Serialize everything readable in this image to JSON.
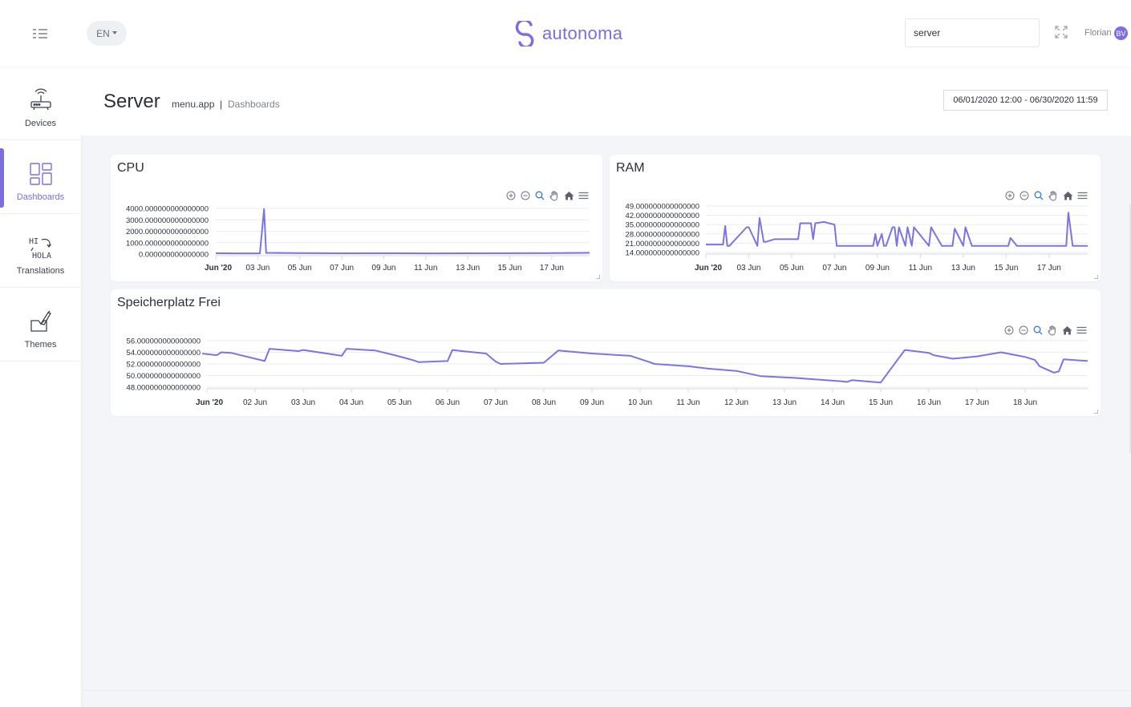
{
  "header": {
    "language": "EN",
    "logo_text": "autonoma",
    "search_value": "server",
    "user_name": "Florian",
    "avatar_initials": "BV"
  },
  "sidebar": {
    "items": [
      {
        "label": "Devices",
        "icon": "router-icon",
        "active": false
      },
      {
        "label": "Dashboards",
        "icon": "dashboard-grid-icon",
        "active": true
      },
      {
        "label": "Translations",
        "icon": "translate-icon",
        "active": false
      },
      {
        "label": "Themes",
        "icon": "paint-brush-icon",
        "active": false
      }
    ],
    "translate_icon_top": "HI",
    "translate_icon_bottom": "HOLA"
  },
  "page": {
    "title": "Server",
    "breadcrumb_app": "menu.app",
    "breadcrumb_sep": "|",
    "breadcrumb_current": "Dashboards",
    "date_range": "06/01/2020 12:00 - 06/30/2020 11:59"
  },
  "colors": {
    "accent": "#7b6ee4",
    "series": "#7c73e6",
    "grid": "#e9ebef",
    "text": "#3c4250"
  },
  "toolbar_icons": [
    "zoom-in-icon",
    "zoom-out-icon",
    "selection-zoom-icon",
    "pan-icon",
    "reset-home-icon",
    "menu-icon"
  ],
  "chart_data": [
    {
      "type": "line",
      "title": "CPU",
      "ytick_labels": [
        "4000.000000000000000",
        "3000.000000000000000",
        "2000.000000000000000",
        "1000.000000000000000",
        "0.000000000000000"
      ],
      "yticks": [
        4000,
        3000,
        2000,
        1000,
        0
      ],
      "ylim": [
        0,
        4000
      ],
      "xlim": [
        1,
        18.8
      ],
      "xticks": [
        {
          "label": "Jun '20",
          "day": 1,
          "bold": true
        },
        {
          "label": "03 Jun",
          "day": 3
        },
        {
          "label": "05 Jun",
          "day": 5
        },
        {
          "label": "07 Jun",
          "day": 7
        },
        {
          "label": "09 Jun",
          "day": 9
        },
        {
          "label": "11 Jun",
          "day": 11
        },
        {
          "label": "13 Jun",
          "day": 13
        },
        {
          "label": "15 Jun",
          "day": 15
        },
        {
          "label": "17 Jun",
          "day": 17
        }
      ],
      "series": [
        {
          "x": [
            1,
            2,
            3.1,
            3.3,
            3.4,
            5,
            7,
            9,
            11,
            13,
            15,
            17,
            18.8
          ],
          "y": [
            80,
            60,
            60,
            3950,
            110,
            90,
            70,
            80,
            60,
            70,
            80,
            90,
            110
          ]
        }
      ]
    },
    {
      "type": "line",
      "title": "RAM",
      "ytick_labels": [
        "49.000000000000000",
        "42.000000000000000",
        "35.000000000000000",
        "28.000000000000000",
        "21.000000000000000",
        "14.000000000000000"
      ],
      "yticks": [
        49,
        42,
        35,
        28,
        21,
        14
      ],
      "ylim": [
        14,
        49
      ],
      "xlim": [
        1,
        18.8
      ],
      "xticks": [
        {
          "label": "Jun '20",
          "day": 1,
          "bold": true
        },
        {
          "label": "03 Jun",
          "day": 3
        },
        {
          "label": "05 Jun",
          "day": 5
        },
        {
          "label": "07 Jun",
          "day": 7
        },
        {
          "label": "09 Jun",
          "day": 9
        },
        {
          "label": "11 Jun",
          "day": 11
        },
        {
          "label": "13 Jun",
          "day": 13
        },
        {
          "label": "15 Jun",
          "day": 15
        },
        {
          "label": "17 Jun",
          "day": 17
        }
      ],
      "series": [
        {
          "x": [
            1,
            1.8,
            1.9,
            2.0,
            2.1,
            2.9,
            3.0,
            3.4,
            3.5,
            3.7,
            3.8,
            4.2,
            4.5,
            5.3,
            5.4,
            5.9,
            6.0,
            6.1,
            6.5,
            7.0,
            7.1,
            7.5,
            7.6,
            8.8,
            8.9,
            9.0,
            9.2,
            9.3,
            9.4,
            9.7,
            9.8,
            9.9,
            10.0,
            10.3,
            10.4,
            10.6,
            10.7,
            11.4,
            11.5,
            12.0,
            12.1,
            12.5,
            12.6,
            13.0,
            13.1,
            13.4,
            13.5,
            13.8,
            15.0,
            15.1,
            15.2,
            15.5,
            17.0,
            17.8,
            17.9,
            18.1,
            18.8
          ],
          "y": [
            20,
            20,
            34,
            19,
            19,
            33,
            33,
            19,
            40,
            22,
            22,
            24,
            24,
            24,
            36,
            36,
            24,
            36,
            37,
            35,
            19,
            19,
            19,
            19,
            28,
            19,
            28,
            19,
            19,
            33,
            33,
            19,
            33,
            19,
            33,
            19,
            33,
            19,
            33,
            19,
            19,
            19,
            32,
            19,
            33,
            19,
            19,
            19,
            19,
            19,
            25,
            19,
            19,
            19,
            44,
            19,
            19
          ]
        }
      ]
    },
    {
      "type": "line",
      "title": "Speicherplatz Frei",
      "ytick_labels": [
        "56.000000000000000",
        "54.000000000000000",
        "52.000000000000000",
        "50.000000000000000",
        "48.000000000000000"
      ],
      "yticks": [
        56,
        54,
        52,
        50,
        48
      ],
      "ylim": [
        48,
        56
      ],
      "xlim": [
        1,
        19.3
      ],
      "xticks": [
        {
          "label": "Jun '20",
          "day": 1,
          "bold": true
        },
        {
          "label": "02 Jun",
          "day": 2
        },
        {
          "label": "03 Jun",
          "day": 3
        },
        {
          "label": "04 Jun",
          "day": 4
        },
        {
          "label": "05 Jun",
          "day": 5
        },
        {
          "label": "06 Jun",
          "day": 6
        },
        {
          "label": "07 Jun",
          "day": 7
        },
        {
          "label": "08 Jun",
          "day": 8
        },
        {
          "label": "09 Jun",
          "day": 9
        },
        {
          "label": "10 Jun",
          "day": 10
        },
        {
          "label": "11 Jun",
          "day": 11
        },
        {
          "label": "12 Jun",
          "day": 12
        },
        {
          "label": "13 Jun",
          "day": 13
        },
        {
          "label": "14 Jun",
          "day": 14
        },
        {
          "label": "15 Jun",
          "day": 15
        },
        {
          "label": "16 Jun",
          "day": 16
        },
        {
          "label": "17 Jun",
          "day": 17
        },
        {
          "label": "18 Jun",
          "day": 18
        }
      ],
      "series": [
        {
          "x": [
            0.9,
            1.2,
            1.3,
            1.5,
            2.2,
            2.3,
            2.9,
            3.0,
            3.8,
            3.9,
            4.5,
            4.9,
            5.3,
            5.4,
            6.0,
            6.1,
            6.3,
            6.8,
            7.0,
            7.1,
            8.0,
            8.3,
            9.0,
            9.8,
            10.2,
            10.3,
            11.0,
            11.4,
            12.0,
            12.5,
            13.2,
            14.2,
            14.3,
            14.4,
            15.0,
            15.5,
            16.0,
            16.1,
            16.5,
            17.0,
            17.5,
            18.0,
            18.2,
            18.3,
            18.6,
            18.7,
            18.8,
            19.3
          ],
          "y": [
            53.8,
            53.5,
            54,
            53.9,
            52.5,
            54.6,
            54.2,
            54.4,
            53.4,
            54.6,
            54.3,
            53.5,
            52.6,
            52.3,
            52.5,
            54.4,
            54.2,
            53.8,
            52.4,
            52.0,
            52.2,
            54.3,
            53.8,
            53.4,
            52.3,
            52.0,
            51.6,
            51.2,
            50.8,
            49.9,
            49.6,
            49.0,
            48.9,
            49.2,
            48.8,
            54.4,
            53.9,
            53.5,
            52.9,
            53.3,
            54.0,
            53.2,
            52.7,
            51.6,
            50.5,
            50.7,
            52.8,
            52.5
          ]
        }
      ]
    }
  ]
}
